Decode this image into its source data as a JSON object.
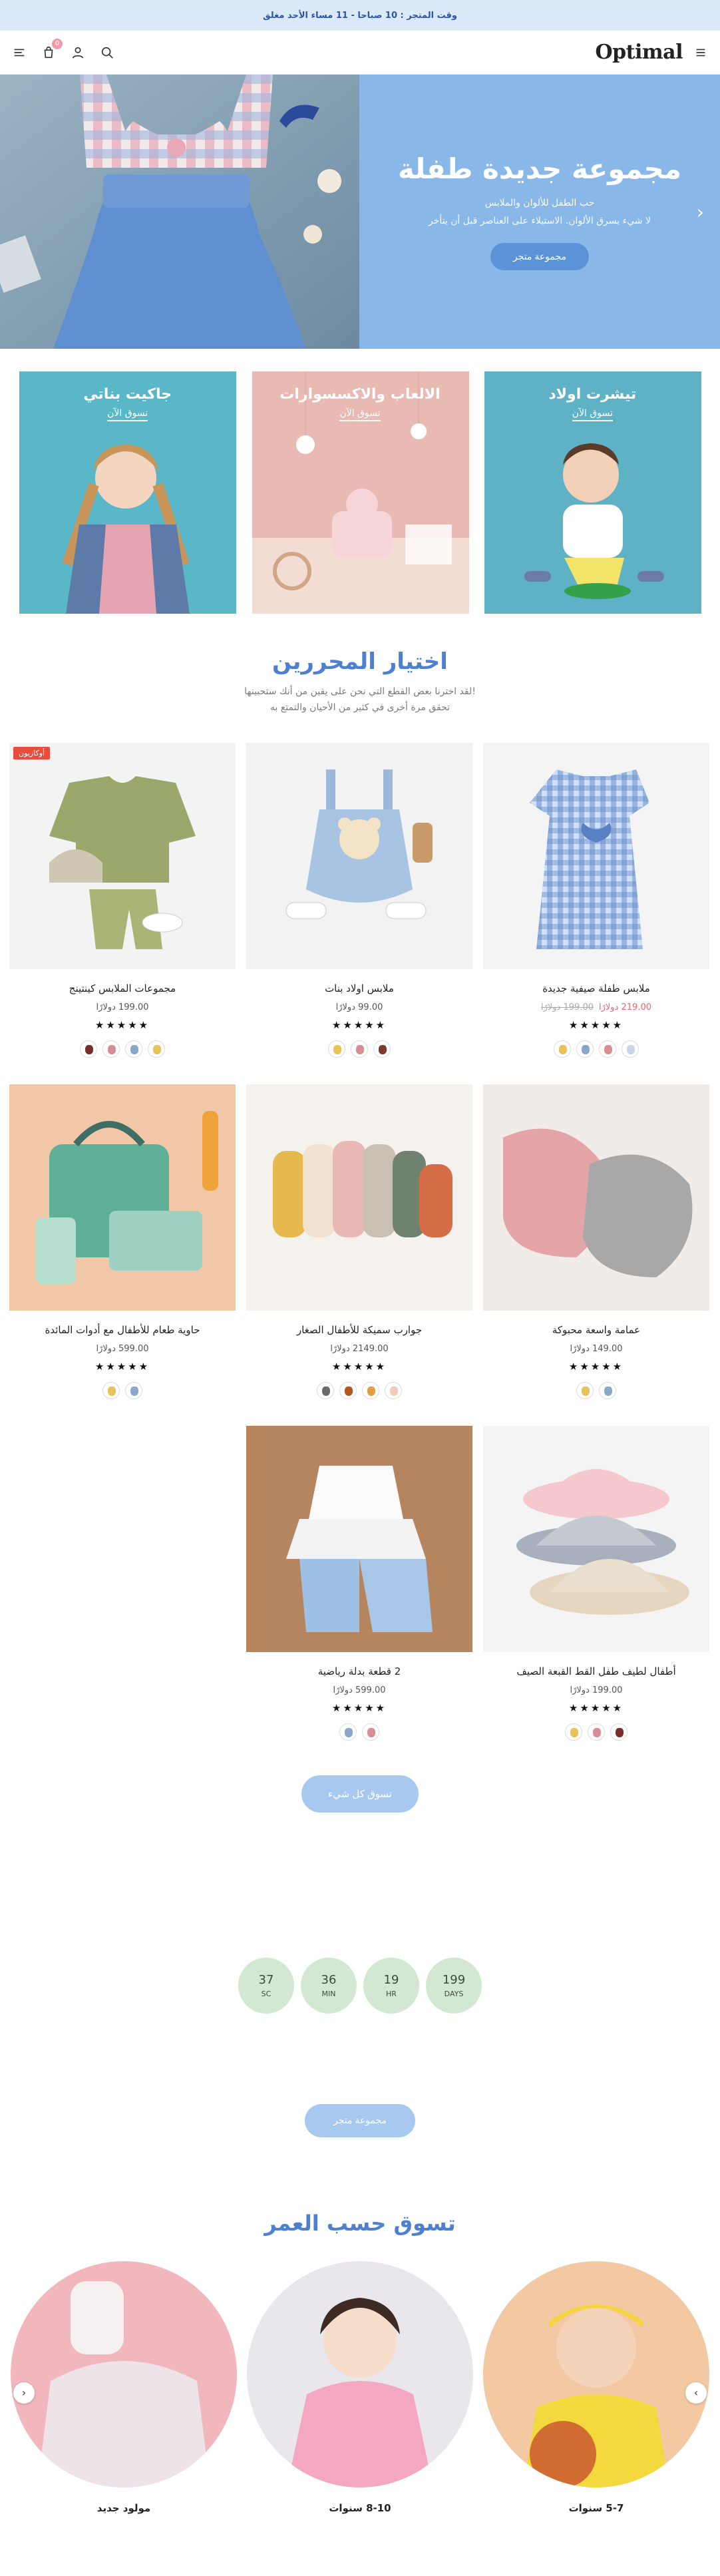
{
  "announcement": "وقت المتجر : 10 صباحا - 11 مساء الأحد مغلق",
  "header": {
    "logo": "Optimal",
    "cart_count": "0"
  },
  "hero": {
    "title": "مجموعة جديدة طفلة",
    "subtitle_1": "حب الطفل للألوان والملابس",
    "subtitle_2": "لا شيء يسرق الألوان. الاستيلاء على العناصر قبل أن يتأخر",
    "button": "مجموعة متجر"
  },
  "categories": [
    {
      "title": "تيشرت اولاد",
      "link": "تسوق الآن"
    },
    {
      "title": "الالعاب والاكسسوارات",
      "link": "تسوق الآن"
    },
    {
      "title": "جاكيت بناتي",
      "link": "تسوق الآن"
    }
  ],
  "editors": {
    "title": "اختيار المحررين",
    "sub_1": "لقد اخترنا بعض القطع التي نحن على يقين من أنك ستحبينها!",
    "sub_2": "تحقق مرة أخرى في كثير من الأحيان والتمتع به"
  },
  "products": [
    {
      "name": "ملابس طفلة صيفية جديدة",
      "price": "219.00 دولارًا",
      "old_price": "199.00 دولارًا",
      "stars": "★★★★★",
      "colors": [
        "#e8c25a",
        "#8aa6c9",
        "#d98e96",
        "#c9d4e4"
      ]
    },
    {
      "name": "ملابس اولاد بنات",
      "price": "99.00 دولارًا",
      "stars": "★★★★★",
      "colors": [
        "#e8c25a",
        "#d98e96",
        "#7a3b2e"
      ]
    },
    {
      "name": "مجموعات الملابس كينتينج",
      "price": "199.00 دولارًا",
      "stars": "★★★★★",
      "badge": "أوكازيون",
      "colors": [
        "#7a2e2a",
        "#d98e96",
        "#8aa6c9",
        "#e8c25a"
      ]
    },
    {
      "name": "عمامة واسعة محبوكة",
      "price": "149.00 دولارًا",
      "stars": "★★★★★",
      "colors": [
        "#e8c25a",
        "#8aa6c9"
      ]
    },
    {
      "name": "جوارب سميكة للأطفال الصغار",
      "price": "2149.00 دولارًا",
      "stars": "★★★★★",
      "colors": [
        "#6b6b6b",
        "#b5581f",
        "#e0a040",
        "#f1cbb8"
      ]
    },
    {
      "name": "حاوية طعام للأطفال مع أدوات المائدة",
      "price": "599.00 دولارًا",
      "stars": "★★★★★",
      "colors": [
        "#e8c25a",
        "#8aa6c9"
      ]
    },
    {
      "name": "أطفال لطيف طفل القط القبعة الصيف",
      "price": "199.00 دولارًا",
      "stars": "★★★★★",
      "colors": [
        "#e8c25a",
        "#d98e96",
        "#7a2e2a"
      ]
    },
    {
      "name": "2 قطعة بدلة رياضية",
      "price": "599.00 دولارًا",
      "stars": "★★★★★",
      "colors": [
        "#8aa6c9",
        "#d98e96"
      ]
    }
  ],
  "shop_all": "تسوق كل شيء",
  "countdown": [
    {
      "value": "199",
      "unit": "DAYS"
    },
    {
      "value": "19",
      "unit": "HR"
    },
    {
      "value": "36",
      "unit": "MIN"
    },
    {
      "value": "37",
      "unit": "SC"
    }
  ],
  "collection_button": "مجموعة متجر",
  "shop_by_age": {
    "title": "تسوق حسب العمر",
    "items": [
      "5-7 سنوات",
      "8-10 سنوات",
      "مولود جديد"
    ]
  }
}
